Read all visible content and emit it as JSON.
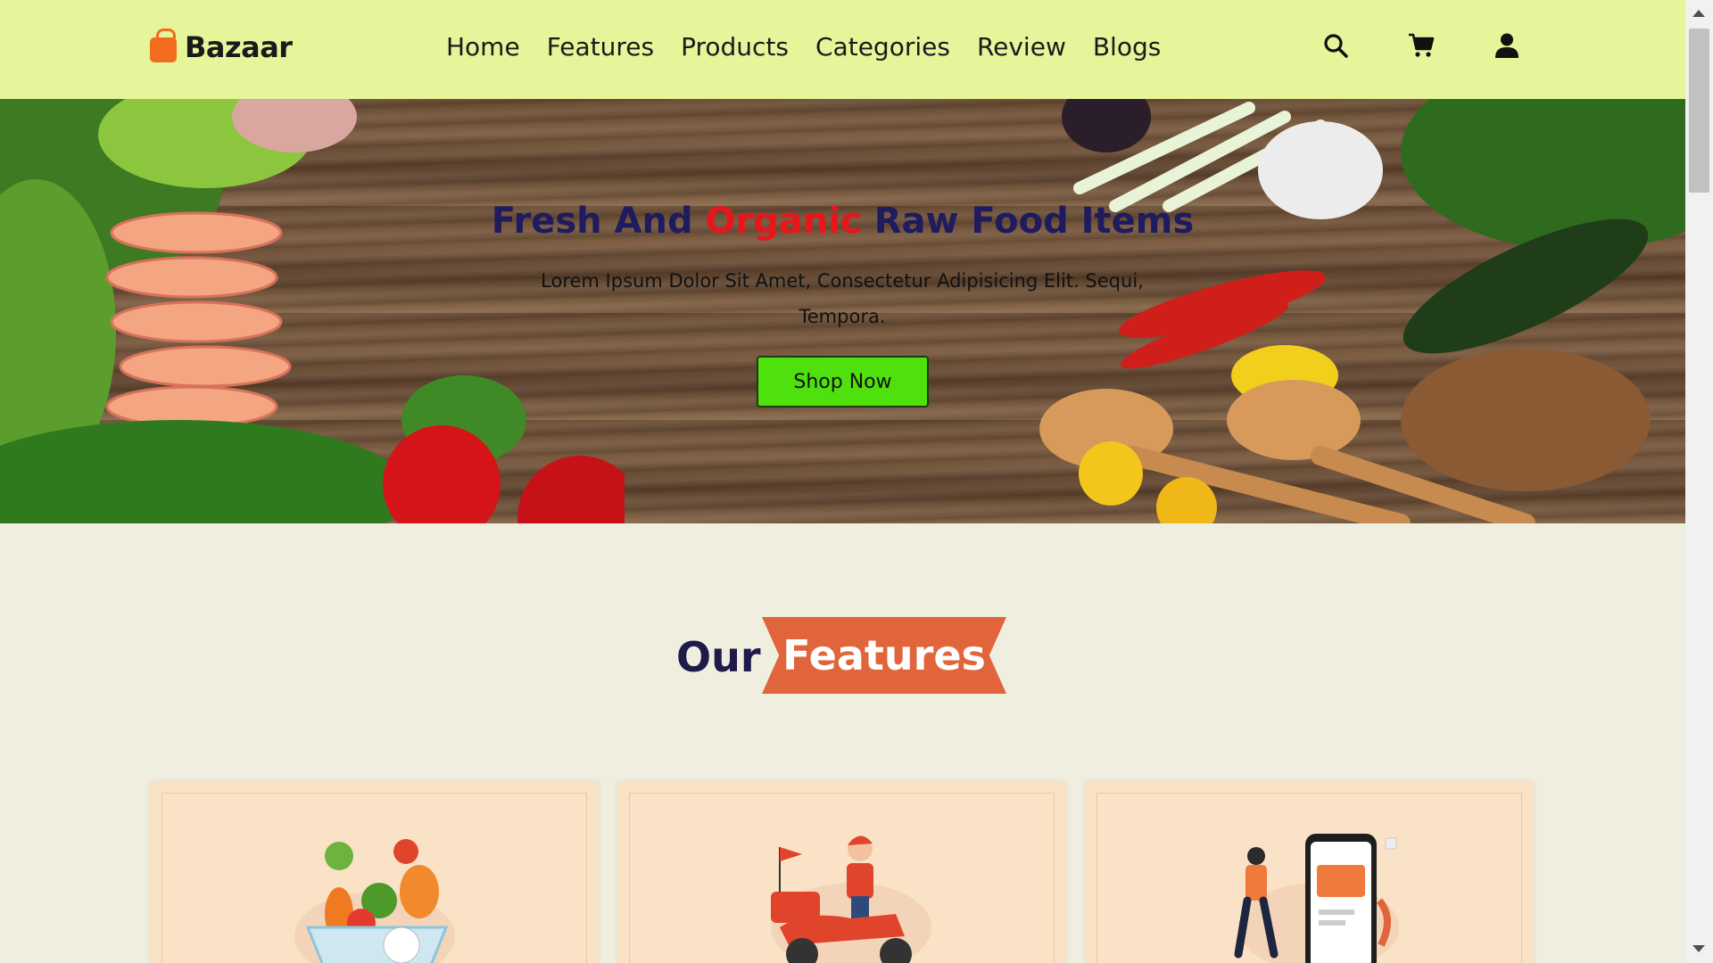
{
  "brand": {
    "name": "Bazaar",
    "logo_icon": "shopping-bag-icon",
    "logo_color": "#f26c1f"
  },
  "nav": {
    "items": [
      {
        "label": "Home"
      },
      {
        "label": "Features"
      },
      {
        "label": "Products"
      },
      {
        "label": "Categories"
      },
      {
        "label": "Review"
      },
      {
        "label": "Blogs"
      }
    ]
  },
  "header_icons": [
    "search-icon",
    "cart-icon",
    "user-icon"
  ],
  "hero": {
    "title_before": "Fresh And ",
    "title_accent": "Organic",
    "title_after": " Raw Food Items",
    "description": "Lorem Ipsum Dolor Sit Amet, Consectetur Adipisicing Elit. Sequi, Tempora.",
    "cta_label": "Shop Now",
    "cta_color": "#4ee10e",
    "accent_color": "#e8161b"
  },
  "features": {
    "heading_plain": "Our",
    "heading_ribbon": "Features",
    "ribbon_color": "#e0653a",
    "cards": [
      {
        "illustration": "vegetable-basket-illustration"
      },
      {
        "illustration": "delivery-scooter-illustration"
      },
      {
        "illustration": "mobile-payment-illustration"
      }
    ]
  },
  "colors": {
    "header_bg": "#e6f59a",
    "page_bg": "#f0efdf",
    "card_bg": "#f9e2c6"
  }
}
